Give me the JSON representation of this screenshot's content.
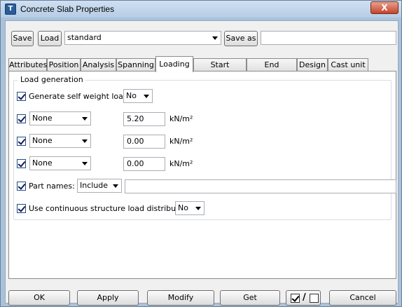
{
  "window": {
    "title": "Concrete Slab Properties",
    "close_label": "X",
    "app_icon_glyph": "T"
  },
  "toolbar": {
    "save_label": "Save",
    "load_label": "Load",
    "preset_value": "standard",
    "save_as_label": "Save as",
    "save_as_value": ""
  },
  "tabs": [
    {
      "label": "Attributes"
    },
    {
      "label": "Position"
    },
    {
      "label": "Analysis"
    },
    {
      "label": "Spanning"
    },
    {
      "label": "Loading",
      "active": true
    },
    {
      "label": "Start releases"
    },
    {
      "label": "End releases"
    },
    {
      "label": "Design"
    },
    {
      "label": "Cast unit"
    }
  ],
  "load_generation": {
    "group_title": "Load generation",
    "self_weight": {
      "label": "Generate self weight load",
      "checked": true,
      "value": "No"
    },
    "loads": [
      {
        "checked": true,
        "type": "None",
        "value": "5.20",
        "unit": "kN/m²"
      },
      {
        "checked": true,
        "type": "None",
        "value": "0.00",
        "unit": "kN/m²"
      },
      {
        "checked": true,
        "type": "None",
        "value": "0.00",
        "unit": "kN/m²"
      }
    ],
    "part_names": {
      "label": "Part names:",
      "checked": true,
      "mode": "Include",
      "value": ""
    },
    "continuous": {
      "label": "Use continuous structure load distribution",
      "checked": true,
      "value": "No"
    }
  },
  "footer": {
    "ok_label": "OK",
    "apply_label": "Apply",
    "modify_label": "Modify",
    "get_label": "Get",
    "toggle_separator": "/",
    "cancel_label": "Cancel"
  }
}
